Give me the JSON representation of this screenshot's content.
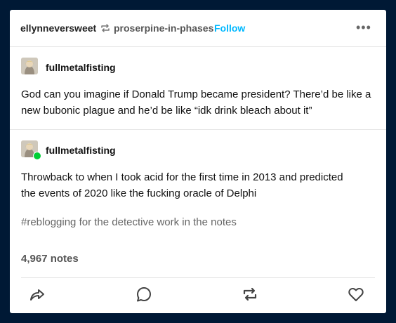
{
  "header": {
    "username": "ellynneversweet",
    "source": "proserpine-in-phases",
    "follow_label": "Follow",
    "more_label": "•••"
  },
  "posts": [
    {
      "username": "fullmetalfisting",
      "text": "God can you imagine if Donald Trump became president? There’d be like a new bubonic plague and he’d be like “idk drink bleach about it”"
    },
    {
      "username": "fullmetalfisting",
      "text": "Throwback to when I took acid for the first time in 2013 and predicted the events of 2020 like the fucking oracle of Delphi"
    }
  ],
  "tags": [
    "#reblogging for the detective work in the notes"
  ],
  "notes": "4,967 notes",
  "actions": [
    "share-icon",
    "reply-icon",
    "reblog-icon",
    "like-icon"
  ],
  "colors": {
    "background": "#001935",
    "follow": "#00b8ff",
    "badge": "#00cf35"
  }
}
